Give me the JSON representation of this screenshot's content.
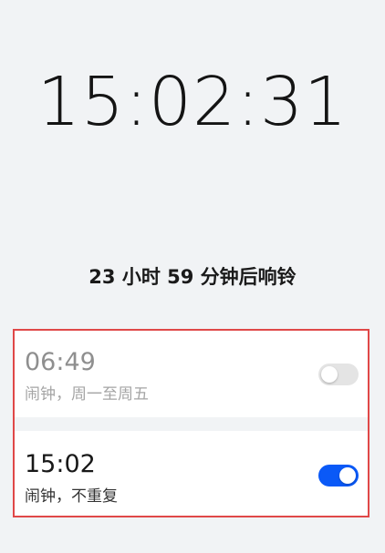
{
  "clock": {
    "time": "15:02:31"
  },
  "next_alarm": {
    "text": "23 小时 59 分钟后响铃"
  },
  "alarms": [
    {
      "time": "06:49",
      "description": "闹钟，周一至周五",
      "enabled": false
    },
    {
      "time": "15:02",
      "description": "闹钟，不重复",
      "enabled": true
    }
  ],
  "colors": {
    "background": "#f1f3f5",
    "card": "#ffffff",
    "toggle_on": "#0a59f7",
    "toggle_off": "#e4e4e4",
    "highlight_border": "#e04848"
  }
}
